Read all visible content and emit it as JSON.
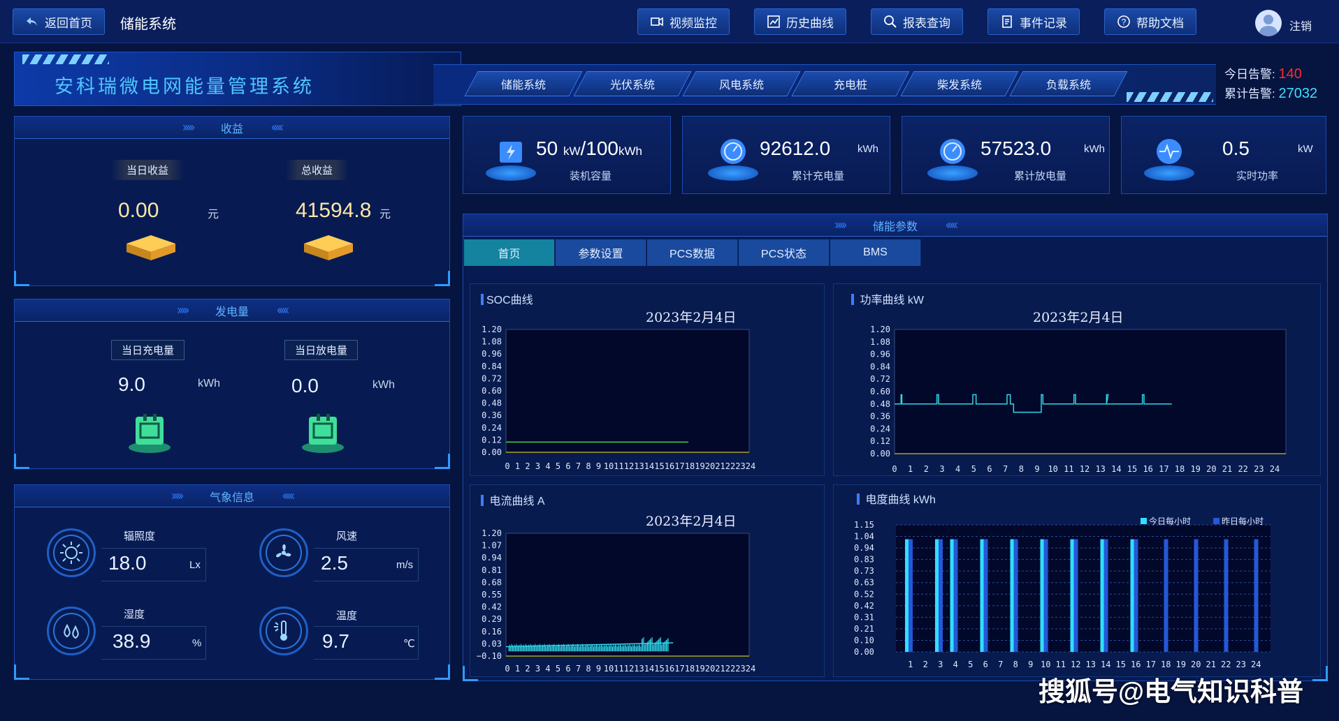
{
  "topbar": {
    "back_label": "返回首页",
    "page_title": "储能系统",
    "nav": [
      {
        "label": "视频监控",
        "icon": "video-icon"
      },
      {
        "label": "历史曲线",
        "icon": "chart-line-icon"
      },
      {
        "label": "报表查询",
        "icon": "search-icon"
      },
      {
        "label": "事件记录",
        "icon": "document-icon"
      },
      {
        "label": "帮助文档",
        "icon": "help-icon"
      }
    ],
    "logout_label": "注销"
  },
  "header": {
    "system_title": "安科瑞微电网能量管理系统",
    "tabs": [
      "储能系统",
      "光伏系统",
      "风电系统",
      "充电桩",
      "柴发系统",
      "负载系统"
    ],
    "alarm_today_label": "今日告警:",
    "alarm_today_value": "140",
    "alarm_total_label": "累计告警:",
    "alarm_total_value": "27032"
  },
  "revenue": {
    "title": "收益",
    "today_label": "当日收益",
    "today_value": "0.00",
    "today_unit": "元",
    "total_label": "总收益",
    "total_value": "41594.8",
    "total_unit": "元"
  },
  "generation": {
    "title": "发电量",
    "charge_label": "当日充电量",
    "charge_value": "9.0",
    "charge_unit": "kWh",
    "discharge_label": "当日放电量",
    "discharge_value": "0.0",
    "discharge_unit": "kWh"
  },
  "weather": {
    "title": "气象信息",
    "irradiance_label": "辐照度",
    "irradiance_value": "18.0",
    "irradiance_unit": "Lx",
    "wind_label": "风速",
    "wind_value": "2.5",
    "wind_unit": "m/s",
    "humidity_label": "湿度",
    "humidity_value": "38.9",
    "humidity_unit": "%",
    "temp_label": "温度",
    "temp_value": "9.7",
    "temp_unit": "℃"
  },
  "cards": [
    {
      "value": "50",
      "unit1": "kW",
      "sep": "/100",
      "unit2": "kWh",
      "label": "装机容量",
      "icon": "battery-icon"
    },
    {
      "value": "92612.0",
      "unit": "kWh",
      "label": "累计充电量",
      "icon": "gauge-icon"
    },
    {
      "value": "57523.0",
      "unit": "kWh",
      "label": "累计放电量",
      "icon": "gauge-icon"
    },
    {
      "value": "0.5",
      "unit": "kW",
      "label": "实时功率",
      "icon": "pulse-icon"
    }
  ],
  "storage": {
    "title": "储能参数",
    "tabs": [
      "首页",
      "参数设置",
      "PCS数据",
      "PCS状态",
      "BMS"
    ],
    "active_tab": "首页"
  },
  "chart_data": [
    {
      "type": "line",
      "title": "SOC曲线",
      "date": "2023年2月4日",
      "yticks": [
        "1.20",
        "1.08",
        "0.96",
        "0.84",
        "0.72",
        "0.60",
        "0.48",
        "0.36",
        "0.24",
        "0.12",
        "0.00"
      ],
      "xticks": [
        "0",
        "1",
        "2",
        "3",
        "4",
        "5",
        "6",
        "7",
        "8",
        "9",
        "10",
        "11",
        "12",
        "13",
        "14",
        "15",
        "16",
        "17",
        "18",
        "19",
        "20",
        "21",
        "22",
        "23",
        "24"
      ],
      "ylim": [
        0,
        1.2
      ],
      "series": [
        {
          "color": "#3fd24a",
          "x": [
            0,
            18
          ],
          "y": [
            0.1,
            0.1
          ]
        }
      ]
    },
    {
      "type": "line",
      "title": "功率曲线",
      "title_unit": "kW",
      "date": "2023年2月4日",
      "yticks": [
        "1.20",
        "1.08",
        "0.96",
        "0.84",
        "0.72",
        "0.60",
        "0.48",
        "0.36",
        "0.24",
        "0.12",
        "0.00"
      ],
      "xticks": [
        "0",
        "1",
        "2",
        "3",
        "4",
        "5",
        "6",
        "7",
        "8",
        "9",
        "10",
        "11",
        "12",
        "13",
        "14",
        "15",
        "16",
        "17",
        "18",
        "19",
        "20",
        "21",
        "22",
        "23",
        "24"
      ],
      "ylim": [
        0,
        1.2
      ],
      "series": [
        {
          "color": "#2fd6e8",
          "x": [
            0,
            0.4,
            0.4,
            0.45,
            0.45,
            2.6,
            2.6,
            2.7,
            2.7,
            4.8,
            4.8,
            5,
            5,
            6.9,
            6.9,
            7.1,
            7.1,
            7.3,
            7.3,
            9,
            9,
            9.1,
            9.1,
            11,
            11,
            11.1,
            11.1,
            13,
            13,
            13.1,
            13,
            15.2,
            15.2,
            15.3,
            15.3,
            17
          ],
          "y": [
            0.48,
            0.48,
            0.57,
            0.57,
            0.48,
            0.48,
            0.57,
            0.57,
            0.48,
            0.48,
            0.57,
            0.57,
            0.48,
            0.48,
            0.57,
            0.57,
            0.48,
            0.48,
            0.4,
            0.4,
            0.57,
            0.57,
            0.48,
            0.48,
            0.57,
            0.57,
            0.48,
            0.48,
            0.57,
            0.57,
            0.48,
            0.48,
            0.57,
            0.57,
            0.48,
            0.48
          ]
        }
      ]
    },
    {
      "type": "line",
      "title": "电流曲线",
      "title_unit": "A",
      "date": "2023年2月4日",
      "yticks": [
        "1.20",
        "1.07",
        "0.94",
        "0.81",
        "0.68",
        "0.55",
        "0.42",
        "0.29",
        "0.16",
        "0.03",
        "−0.10"
      ],
      "xticks": [
        "0",
        "1",
        "2",
        "3",
        "4",
        "5",
        "6",
        "7",
        "8",
        "9",
        "10",
        "11",
        "12",
        "13",
        "14",
        "15",
        "16",
        "17",
        "18",
        "19",
        "20",
        "21",
        "22",
        "23",
        "24"
      ],
      "ylim": [
        -0.1,
        1.2
      ],
      "series": [
        {
          "color": "#2fd6e8",
          "x": [
            0,
            16.5
          ],
          "y": [
            0.0,
            0.04
          ]
        }
      ]
    },
    {
      "type": "bar",
      "title": "电度曲线",
      "title_unit": "kWh",
      "yticks": [
        "1.15",
        "1.04",
        "0.94",
        "0.83",
        "0.73",
        "0.63",
        "0.52",
        "0.42",
        "0.31",
        "0.21",
        "0.10",
        "0.00"
      ],
      "categories": [
        "1",
        "2",
        "3",
        "4",
        "5",
        "6",
        "7",
        "8",
        "9",
        "10",
        "11",
        "12",
        "13",
        "14",
        "15",
        "16",
        "17",
        "18",
        "19",
        "20",
        "21",
        "22",
        "23",
        "24"
      ],
      "ylim": [
        0,
        1.15
      ],
      "series": [
        {
          "name": "今日每小时",
          "color": "#2fe0ff",
          "values": [
            1.02,
            0,
            1.02,
            1.02,
            0,
            1.02,
            0,
            1.02,
            0,
            1.02,
            0,
            1.02,
            0,
            1.02,
            0,
            1.02,
            0,
            0,
            0,
            0,
            0,
            0,
            0,
            0
          ]
        },
        {
          "name": "昨日每小时",
          "color": "#2458d8",
          "values": [
            1.02,
            0,
            1.02,
            1.02,
            0,
            1.02,
            0,
            1.02,
            0,
            1.02,
            0,
            1.02,
            0,
            1.02,
            0,
            1.02,
            0,
            1.02,
            0,
            1.02,
            0,
            1.02,
            0,
            1.02
          ]
        }
      ]
    }
  ],
  "watermark": "搜狐号@电气知识科普"
}
